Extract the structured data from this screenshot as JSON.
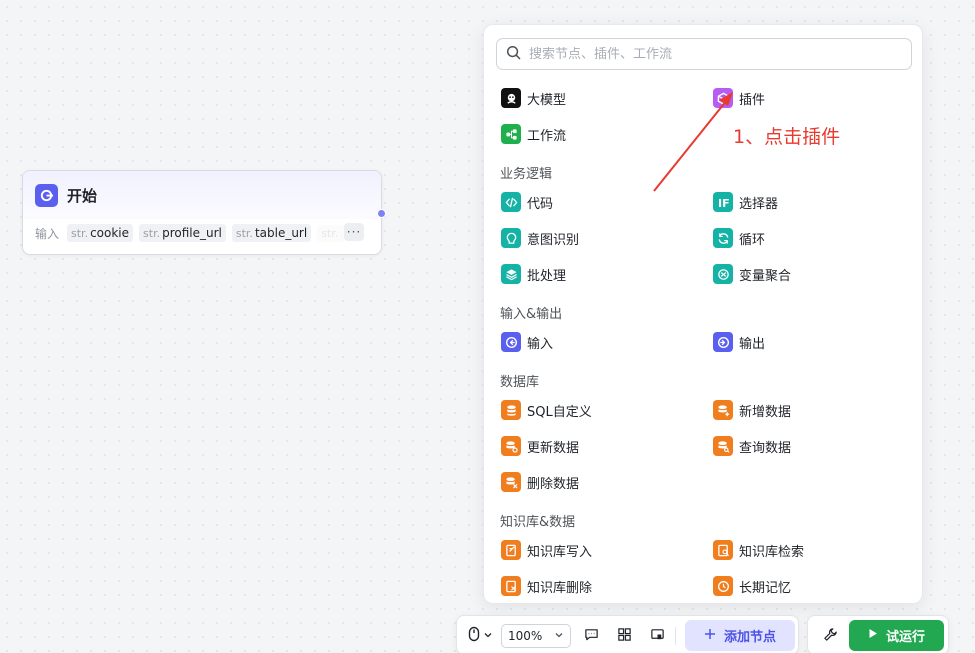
{
  "start_node": {
    "title": "开始",
    "io_label": "输入",
    "params": [
      {
        "type": "str.",
        "name": "cookie"
      },
      {
        "type": "str.",
        "name": "profile_url"
      },
      {
        "type": "str.",
        "name": "table_url"
      },
      {
        "type": "str.",
        "name": ""
      }
    ],
    "more": "···",
    "accent": "#5a5ff0"
  },
  "panel": {
    "search_placeholder": "搜索节点、插件、工作流",
    "top_items": [
      {
        "label": "大模型",
        "icon": "llm-icon"
      },
      {
        "label": "插件",
        "icon": "plugin-cube-icon"
      },
      {
        "label": "工作流",
        "icon": "workflow-icon"
      }
    ],
    "sections": [
      {
        "title": "业务逻辑",
        "items": [
          {
            "label": "代码",
            "icon": "code-icon"
          },
          {
            "label": "选择器",
            "icon": "if-icon"
          },
          {
            "label": "意图识别",
            "icon": "intent-icon"
          },
          {
            "label": "循环",
            "icon": "loop-icon"
          },
          {
            "label": "批处理",
            "icon": "batch-icon"
          },
          {
            "label": "变量聚合",
            "icon": "variable-merge-icon"
          }
        ]
      },
      {
        "title": "输入&输出",
        "items": [
          {
            "label": "输入",
            "icon": "input-icon"
          },
          {
            "label": "输出",
            "icon": "output-icon"
          }
        ]
      },
      {
        "title": "数据库",
        "items": [
          {
            "label": "SQL自定义",
            "icon": "database-sql-icon"
          },
          {
            "label": "新增数据",
            "icon": "database-add-icon"
          },
          {
            "label": "更新数据",
            "icon": "database-update-icon"
          },
          {
            "label": "查询数据",
            "icon": "database-query-icon"
          },
          {
            "label": "删除数据",
            "icon": "database-delete-icon"
          }
        ]
      },
      {
        "title": "知识库&数据",
        "items": [
          {
            "label": "知识库写入",
            "icon": "knowledge-write-icon"
          },
          {
            "label": "知识库检索",
            "icon": "knowledge-search-icon"
          },
          {
            "label": "知识库删除",
            "icon": "knowledge-delete-icon"
          },
          {
            "label": "长期记忆",
            "icon": "long-term-memory-icon"
          }
        ]
      }
    ],
    "colors": {
      "llm": "#111111",
      "plugin": "#b65cf2",
      "workflow": "#1fb04e",
      "logic": "#14b3a6",
      "io": "#5a5ff0",
      "data": "#f07e1f"
    }
  },
  "annotation": {
    "text": "1、点击插件",
    "color": "#e83a2f"
  },
  "toolbar": {
    "zoom": "100%",
    "add_node": "添加节点",
    "run": "试运行",
    "run_color": "#21a851",
    "add_node_color": "#4d53e8"
  }
}
